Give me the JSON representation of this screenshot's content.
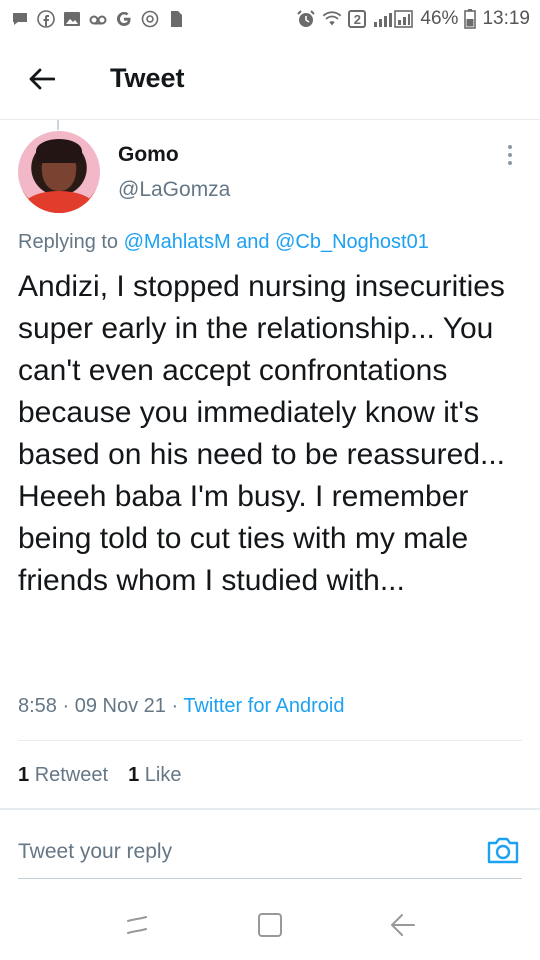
{
  "status_bar": {
    "left_icons": [
      "chat-icon",
      "facebook-icon",
      "image-icon",
      "voicemail-icon",
      "google-icon",
      "instagram-icon",
      "sim-icon"
    ],
    "battery_percent": "46%",
    "time": "13:19",
    "sim_badge": "2"
  },
  "appbar": {
    "title": "Tweet"
  },
  "tweet": {
    "author_name": "Gomo",
    "author_handle": "@LaGomza",
    "replying_prefix": "Replying to",
    "mention1": "@MahlatsM",
    "and_word": "and",
    "mention2": "@Cb_Noghost01",
    "text": "Andizi, I stopped nursing insecurities super early in the relationship... You can't even accept confrontations because you immediately know it's based on his need to be reassured... Heeeh baba I'm busy. I remember being told to cut ties with my male friends whom I studied with...",
    "time": "8:58",
    "date": "09 Nov 21",
    "source": "Twitter for Android",
    "retweet_count": "1",
    "retweet_label": "Retweet",
    "like_count": "1",
    "like_label": "Like"
  },
  "reply": {
    "placeholder": "Tweet your reply"
  },
  "colors": {
    "accent": "#1da1f2",
    "secondary_text": "#657786",
    "primary_text": "#14171a"
  }
}
